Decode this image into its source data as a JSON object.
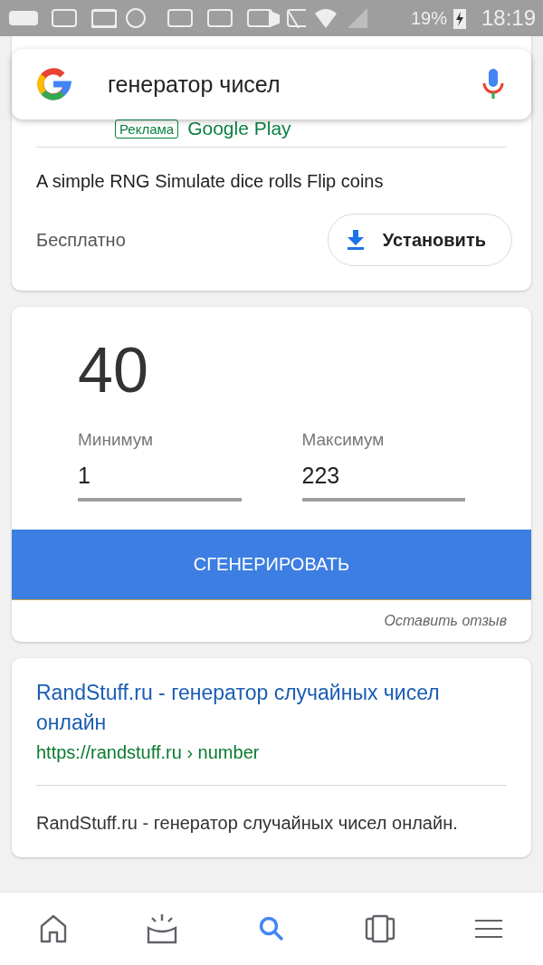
{
  "status_bar": {
    "battery": "19%",
    "time": "18:19"
  },
  "search": {
    "value": "генератор чисел"
  },
  "ad": {
    "badge": "Реклама",
    "source": "Google Play",
    "description": "A simple RNG Simulate dice rolls Flip coins",
    "price": "Бесплатно",
    "install_button": "Установить"
  },
  "generator": {
    "result": "40",
    "min_label": "Минимум",
    "min_value": "1",
    "max_label": "Максимум",
    "max_value": "223",
    "button": "СГЕНЕРИРОВАТЬ",
    "feedback": "Оставить отзыв"
  },
  "result": {
    "title": "RandStuff.ru - генератор случайных чисел онлайн",
    "url": "https://randstuff.ru › number",
    "snippet": "RandStuff.ru - генератор случайных чисел онлайн."
  },
  "bottom_nav": [
    {
      "kind": "home",
      "selected": false
    },
    {
      "kind": "updates",
      "selected": false
    },
    {
      "kind": "search",
      "selected": true
    },
    {
      "kind": "tabs",
      "selected": false
    },
    {
      "kind": "menu",
      "selected": false
    }
  ]
}
